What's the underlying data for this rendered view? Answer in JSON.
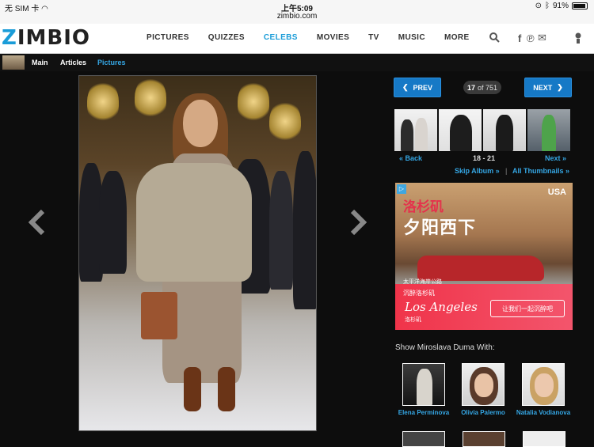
{
  "status_bar": {
    "carrier": "无 SIM 卡",
    "time": "上午5:09",
    "url": "zimbio.com",
    "battery_percent": "91%",
    "battery_level": 0.91
  },
  "nav": {
    "logo_z": "Z",
    "logo_rest": "IMBIO",
    "items": [
      "PICTURES",
      "QUIZZES",
      "CELEBS",
      "MOVIES",
      "TV",
      "MUSIC",
      "MORE"
    ],
    "active": "CELEBS",
    "icons": [
      "search-icon",
      "facebook-icon",
      "pinterest-icon",
      "mail-icon",
      "user-icon"
    ]
  },
  "subnav": {
    "items": [
      "Main",
      "Articles",
      "Pictures"
    ],
    "active": "Pictures"
  },
  "gallery": {
    "prev_label": "PREV",
    "next_label": "NEXT",
    "current": "17",
    "total_text": "of 751",
    "back_label": "« Back",
    "range": "18 - 21",
    "next_link": "Next »",
    "skip_album": "Skip Album »",
    "separator": "|",
    "all_thumbnails": "All Thumbnails »"
  },
  "ad": {
    "badge": "▷",
    "brand": "USA",
    "headline_red": "洛杉矶",
    "headline_white": "夕阳西下",
    "line1": "太平洋海岸公路",
    "line2": "沉醉洛杉矶",
    "script": "Los Angeles",
    "script_cn": "洛杉矶",
    "cta": "让我们一起沉醉吧"
  },
  "show_with": {
    "title": "Show Miroslava Duma With:",
    "people": [
      {
        "name": "Elena Perminova"
      },
      {
        "name": "Olivia Palermo"
      },
      {
        "name": "Natalia Vodianova"
      }
    ]
  },
  "colors": {
    "accent": "#1a9cd8",
    "link": "#35a7e5",
    "button": "#1679c6",
    "page_bg": "#0d0d0d"
  }
}
